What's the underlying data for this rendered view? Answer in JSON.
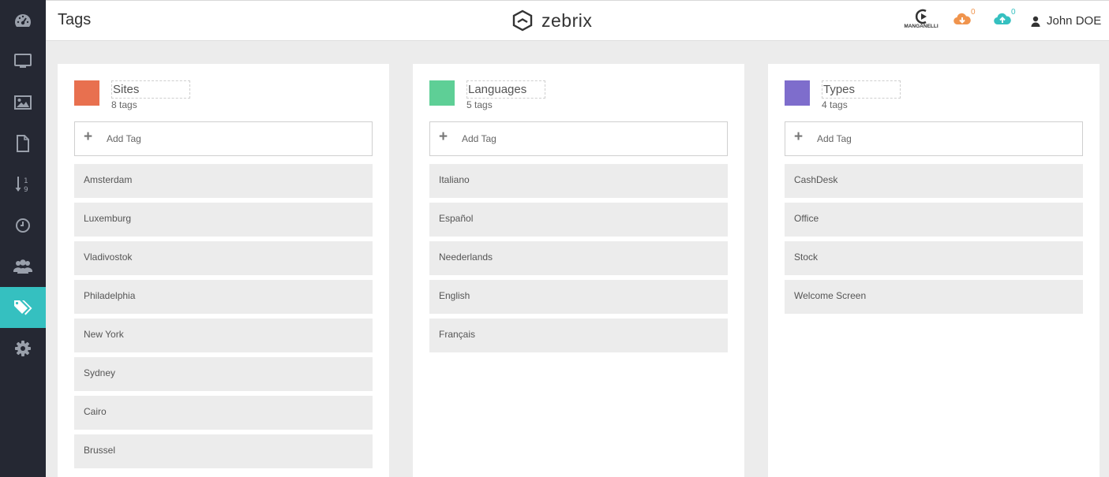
{
  "header": {
    "title": "Tags",
    "brand": "zebrix",
    "partner_logo_text": "MANGANELLI",
    "download_count": "0",
    "upload_count": "0",
    "user_name": "John DOE"
  },
  "sidebar": {
    "items": [
      {
        "icon": "dashboard-icon"
      },
      {
        "icon": "monitor-icon"
      },
      {
        "icon": "image-icon"
      },
      {
        "icon": "document-icon"
      },
      {
        "icon": "sort-numeric-icon"
      },
      {
        "icon": "clock-icon"
      },
      {
        "icon": "users-icon"
      },
      {
        "icon": "tags-icon",
        "active": true
      },
      {
        "icon": "gear-icon"
      }
    ]
  },
  "columns": [
    {
      "name": "Sites",
      "count_label": "8 tags",
      "color": "#e8704f",
      "add_label": "Add Tag",
      "tags": [
        "Amsterdam",
        "Luxemburg",
        "Vladivostok",
        "Philadelphia",
        "New York",
        "Sydney",
        "Cairo",
        "Brussel"
      ]
    },
    {
      "name": "Languages",
      "count_label": "5 tags",
      "color": "#5ecf96",
      "add_label": "Add Tag",
      "tags": [
        "Italiano",
        "Español",
        "Neederlands",
        "English",
        "Français"
      ]
    },
    {
      "name": "Types",
      "count_label": "4 tags",
      "color": "#7e6dcc",
      "add_label": "Add Tag",
      "tags": [
        "CashDesk",
        "Office",
        "Stock",
        "Welcome Screen"
      ]
    }
  ],
  "colors": {
    "sidebar_bg": "#252833",
    "active_accent": "#35c0c0",
    "download_accent": "#f0944d",
    "upload_accent": "#35c0c0"
  }
}
